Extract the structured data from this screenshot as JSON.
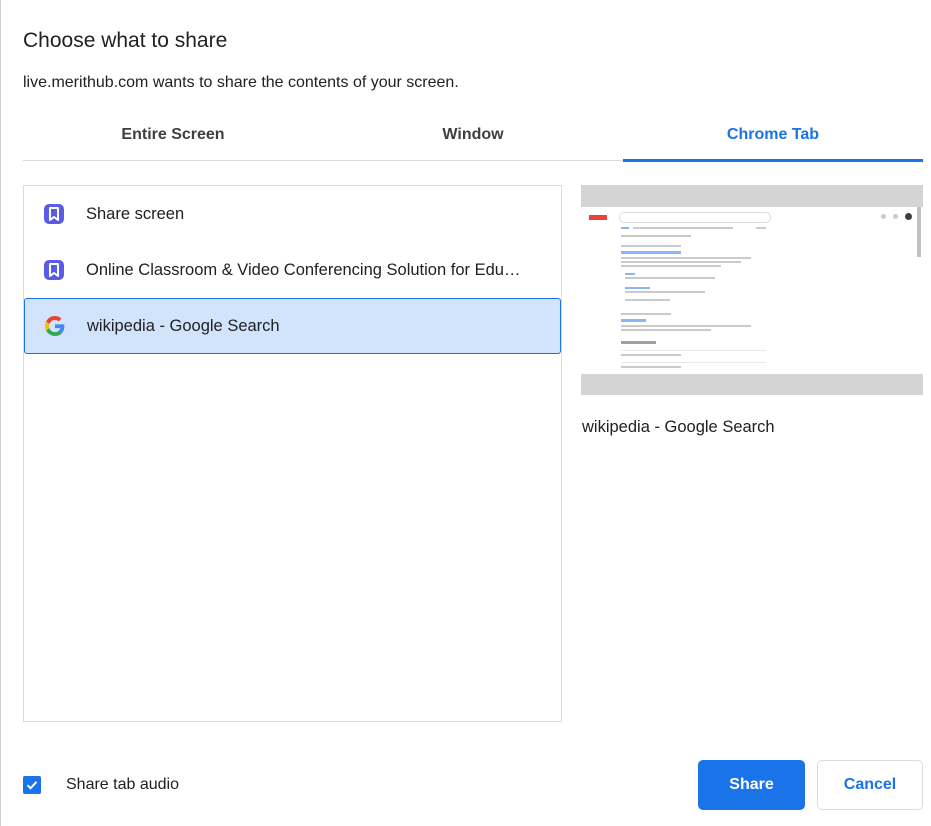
{
  "dialog": {
    "title": "Choose what to share",
    "subtitle": "live.merithub.com wants to share the contents of your screen."
  },
  "tabs": [
    {
      "label": "Entire Screen",
      "active": false
    },
    {
      "label": "Window",
      "active": false
    },
    {
      "label": "Chrome Tab",
      "active": true
    }
  ],
  "sources": [
    {
      "label": "Share screen",
      "icon": "merithub-icon",
      "selected": false
    },
    {
      "label": "Online Classroom & Video Conferencing Solution for Education",
      "icon": "merithub-icon",
      "selected": false
    },
    {
      "label": "wikipedia - Google Search",
      "icon": "google-icon",
      "selected": true
    }
  ],
  "preview": {
    "caption": "wikipedia - Google Search"
  },
  "audio": {
    "label": "Share tab audio",
    "checked": true
  },
  "buttons": {
    "share": "Share",
    "cancel": "Cancel"
  },
  "colors": {
    "accent": "#1a73e8",
    "selected_bg": "#d2e3fc",
    "merithub_icon": "#5b5ce6"
  }
}
